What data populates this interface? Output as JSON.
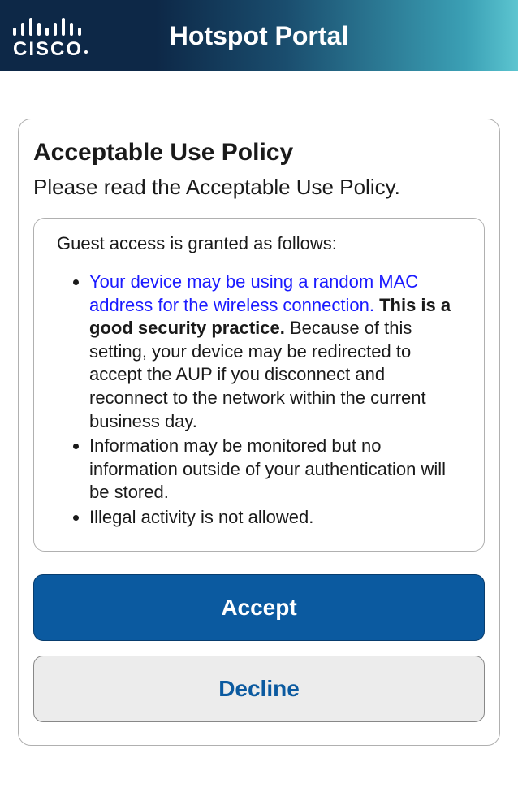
{
  "header": {
    "brand": "cisco",
    "title": "Hotspot Portal"
  },
  "card": {
    "title": "Acceptable Use Policy",
    "subtitle": "Please read the Acceptable Use Policy."
  },
  "policy": {
    "intro": "Guest access is granted as follows:",
    "items": [
      {
        "highlight": "Your device may be using a random MAC address for the wireless connection.",
        "bold": " This is a good security practice.",
        "rest": " Because of this setting, your device may be redirected to accept the AUP if you disconnect and reconnect to the network within the current business day."
      },
      {
        "text": "Information may be monitored but no information outside of your authentication will be stored."
      },
      {
        "text": "Illegal activity is not allowed."
      }
    ]
  },
  "buttons": {
    "accept": "Accept",
    "decline": "Decline"
  }
}
